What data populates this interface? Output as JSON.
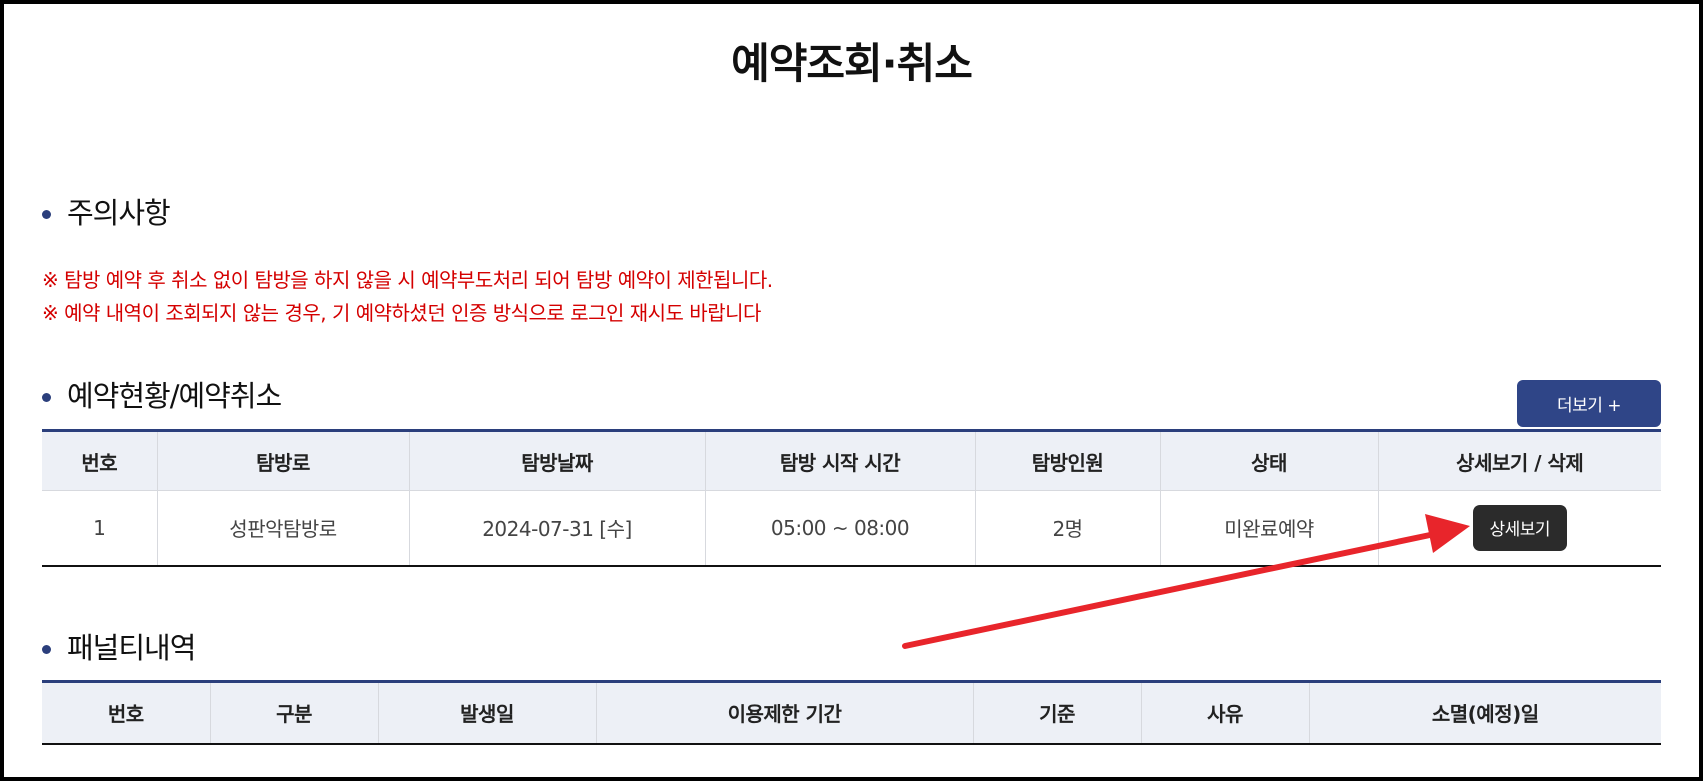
{
  "page": {
    "title": "예약조회·취소"
  },
  "notice_section": {
    "title": "주의사항",
    "lines": [
      "※ 탐방 예약 후 취소 없이 탐방을 하지 않을 시 예약부도처리 되어 탐방 예약이 제한됩니다.",
      "※ 예약 내역이 조회되지 않는 경우, 기 예약하셨던 인증 방식으로 로그인 재시도 바랍니다"
    ]
  },
  "status_section": {
    "title": "예약현황/예약취소",
    "more_label": "더보기 +",
    "columns": [
      "번호",
      "탐방로",
      "탐방날짜",
      "탐방 시작 시간",
      "탐방인원",
      "상태",
      "상세보기 / 삭제"
    ],
    "rows": [
      {
        "no": "1",
        "trail": "성판악탐방로",
        "date": "2024-07-31 [수]",
        "start_time": "05:00 ~ 08:00",
        "people": "2명",
        "status": "미완료예약",
        "detail_label": "상세보기"
      }
    ]
  },
  "penalty_section": {
    "title": "패널티내역",
    "columns": [
      "번호",
      "구분",
      "발생일",
      "이용제한 기간",
      "기준",
      "사유",
      "소멸(예정)일"
    ]
  },
  "colors": {
    "accent_navy": "#2f4587",
    "notice_red": "#d40000",
    "arrow_red": "#e8252b",
    "header_bg": "#edf0f6"
  }
}
